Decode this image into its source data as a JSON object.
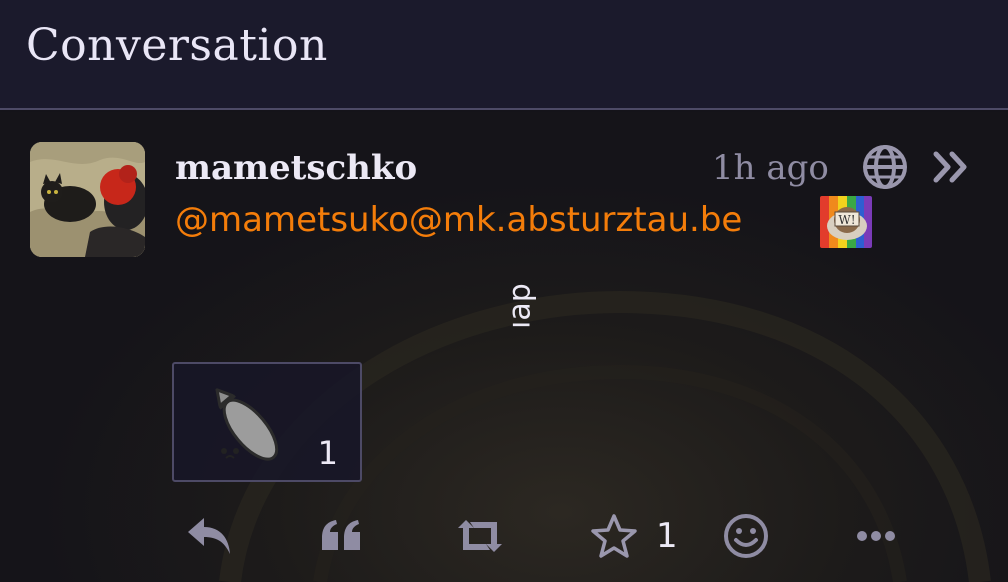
{
  "header": {
    "title": "Conversation"
  },
  "post": {
    "author": {
      "display_name": "mametschko",
      "handle": "@mametsuko@mk.absturztau.be",
      "avatar_icon": "avatar-image",
      "instance_icon": "instance-badge-icon"
    },
    "time": "1h ago",
    "visibility_icon": "globe-icon",
    "expand_icon": "chevrons-right-icon",
    "body": "ıap",
    "reactions": [
      {
        "icon": "bomb-emoji-icon",
        "count": "1"
      }
    ],
    "actions": {
      "reply_icon": "reply-icon",
      "quote_icon": "quote-icon",
      "repeat_icon": "repeat-icon",
      "favorite_icon": "star-icon",
      "favorite_count": "1",
      "react_icon": "smiley-icon",
      "more_icon": "more-icon"
    }
  },
  "colors": {
    "header_bg": "#1b1a2c",
    "accent_handle": "#f47d0a",
    "muted": "#8f8ca3",
    "text": "#ece9f5"
  }
}
